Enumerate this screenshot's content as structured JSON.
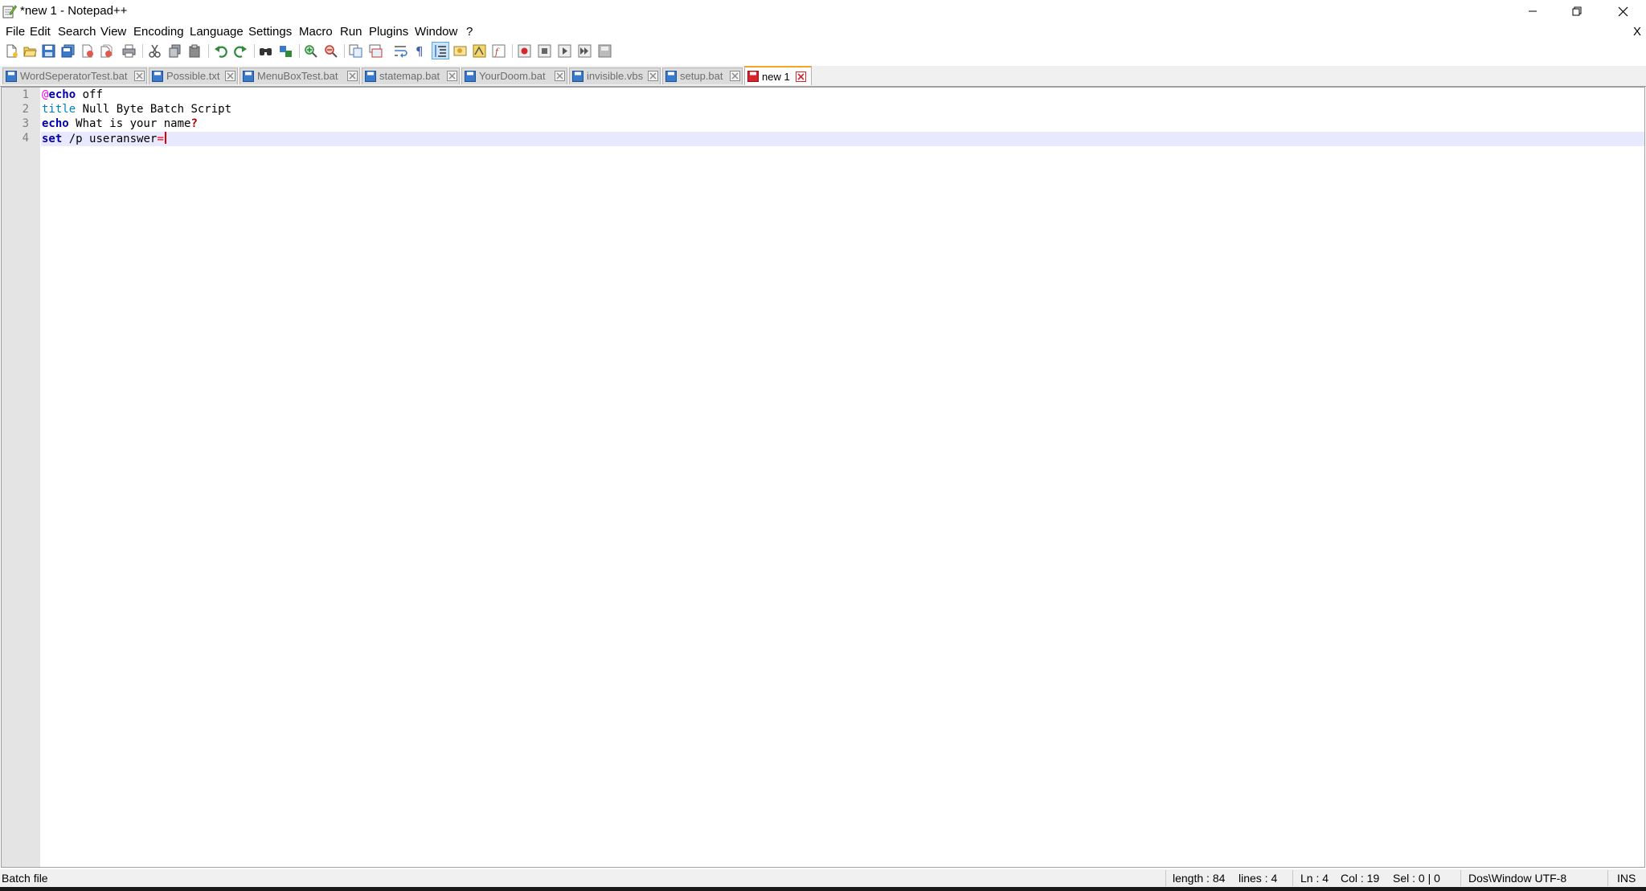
{
  "window": {
    "title": "*new 1 - Notepad++",
    "minimize_glyph": "─",
    "maximize_glyph": "❐",
    "close_glyph": "✕"
  },
  "menu": {
    "items": [
      "File",
      "Edit",
      "Search",
      "View",
      "Encoding",
      "Language",
      "Settings",
      "Macro",
      "Run",
      "Plugins",
      "Window",
      "?"
    ],
    "close_doc_label": "X"
  },
  "toolbar": {
    "buttons": [
      {
        "icon": "new-file-icon"
      },
      {
        "icon": "open-file-icon"
      },
      {
        "icon": "save-icon"
      },
      {
        "icon": "save-all-icon"
      },
      {
        "icon": "close-icon"
      },
      {
        "icon": "close-all-icon"
      },
      {
        "icon": "print-icon"
      },
      {
        "icon": "cut-icon"
      },
      {
        "icon": "copy-icon"
      },
      {
        "icon": "paste-icon"
      },
      {
        "icon": "undo-icon"
      },
      {
        "icon": "redo-icon"
      },
      {
        "icon": "find-icon"
      },
      {
        "icon": "replace-icon"
      },
      {
        "icon": "zoom-in-icon"
      },
      {
        "icon": "zoom-out-icon"
      },
      {
        "icon": "sync-vertical-icon"
      },
      {
        "icon": "sync-horizontal-icon"
      },
      {
        "icon": "word-wrap-icon"
      },
      {
        "icon": "show-all-chars-icon"
      },
      {
        "icon": "indent-guide-icon"
      },
      {
        "icon": "user-language-icon"
      },
      {
        "icon": "doc-map-icon"
      },
      {
        "icon": "function-list-icon"
      },
      {
        "icon": "macro-record-icon"
      },
      {
        "icon": "macro-stop-icon"
      },
      {
        "icon": "macro-play-icon"
      },
      {
        "icon": "macro-run-multiple-icon"
      },
      {
        "icon": "macro-save-icon"
      }
    ]
  },
  "tabs": [
    {
      "label": "WordSeperatorTest.bat",
      "active": false
    },
    {
      "label": "Possible.txt",
      "active": false
    },
    {
      "label": "MenuBoxTest.bat",
      "active": false
    },
    {
      "label": "statemap.bat",
      "active": false
    },
    {
      "label": "YourDoom.bat",
      "active": false
    },
    {
      "label": "invisible.vbs",
      "active": false
    },
    {
      "label": "setup.bat",
      "active": false
    },
    {
      "label": "new 1",
      "active": true
    }
  ],
  "editor": {
    "line_numbers": [
      "1",
      "2",
      "3",
      "4"
    ],
    "lines": [
      {
        "t1": "@",
        "t2": "echo",
        "t3": " off"
      },
      {
        "t1": "title",
        "t2": " Null Byte Batch Script"
      },
      {
        "t1": "echo",
        "t2": " What is your name",
        "t3": "?"
      },
      {
        "t1": "set",
        "t2": " /p useranswer",
        "t3": "="
      }
    ],
    "current_line": 4
  },
  "status": {
    "language": "Batch file",
    "length": "length : 84",
    "lines": "lines : 4",
    "ln": "Ln : 4",
    "col": "Col : 19",
    "sel": "Sel : 0 | 0",
    "eol_encoding": "Dos\\Window UTF-8",
    "mode": "INS"
  },
  "colors": {
    "keyword": "#0000ff",
    "title_cmd": "#0080c0",
    "current_line": "#e8e8ff",
    "gutter": "#e4e4e4",
    "active_tab_accent": "#f5a623"
  }
}
